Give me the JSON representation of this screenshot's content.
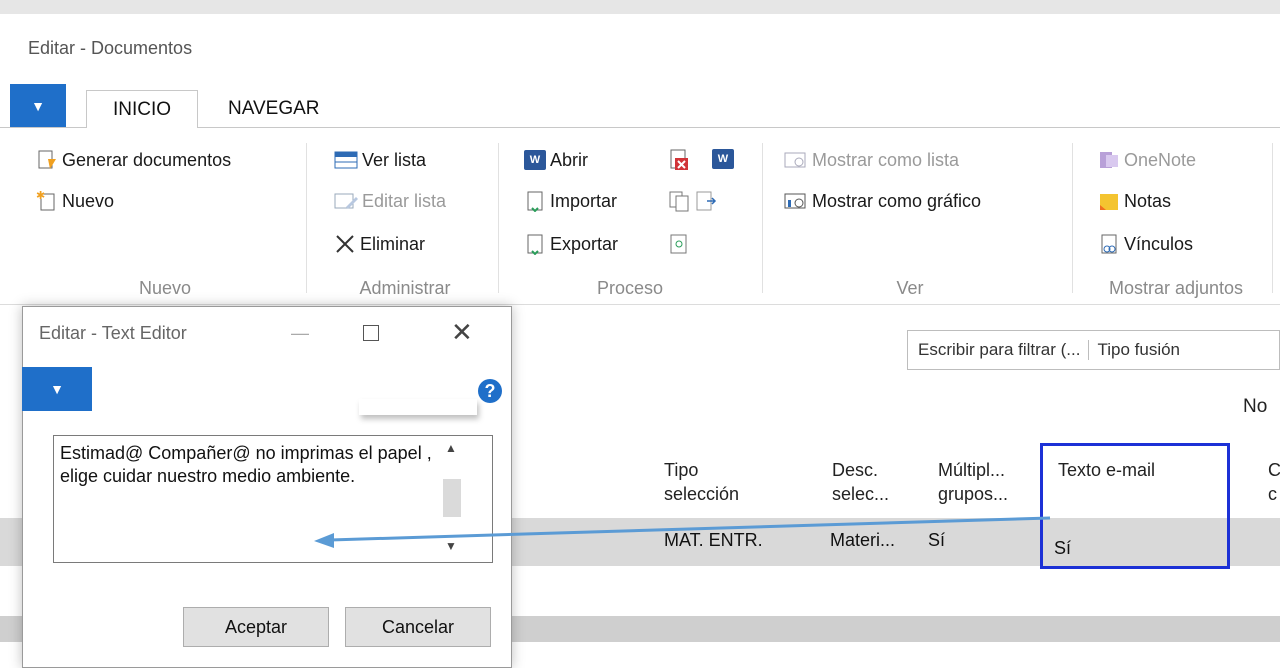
{
  "window": {
    "title": "Editar - Documentos"
  },
  "tabs": [
    {
      "label": "INICIO"
    },
    {
      "label": "NAVEGAR"
    }
  ],
  "ribbon": {
    "nuevo": {
      "items": [
        "Generar documentos",
        "Nuevo"
      ],
      "label": "Nuevo"
    },
    "administrar": {
      "items": [
        "Ver lista",
        "Editar lista",
        "Eliminar"
      ],
      "label": "Administrar"
    },
    "proceso": {
      "items": [
        "Abrir",
        "Importar",
        "Exportar"
      ],
      "label": "Proceso"
    },
    "ver": {
      "items": [
        "Mostrar como lista",
        "Mostrar como gráfico"
      ],
      "label": "Ver"
    },
    "adjuntos": {
      "items": [
        "OneNote",
        "Notas",
        "Vínculos"
      ],
      "label": "Mostrar adjuntos"
    }
  },
  "filter": {
    "search": "Escribir para filtrar (...",
    "field": "Tipo fusión"
  },
  "no_label": "No",
  "grid": {
    "headers": [
      "Tipo selección",
      "Desc. selec...",
      "Múltipl... grupos...",
      "Texto e-mail",
      "C c"
    ],
    "headers_lines": [
      [
        "Tipo",
        "selección"
      ],
      [
        "Desc.",
        "selec..."
      ],
      [
        "Múltipl...",
        "grupos..."
      ],
      [
        "Texto e-mail",
        ""
      ],
      [
        "C",
        "c"
      ]
    ],
    "row": [
      "MAT. ENTR.",
      "Materi...",
      "Sí",
      "Sí"
    ]
  },
  "dialog": {
    "title": "Editar - Text Editor",
    "text": "Estimad@ Compañer@ no imprimas el papel , elige cuidar nuestro medio ambiente.",
    "ok": "Aceptar",
    "cancel": "Cancelar",
    "help": "?"
  },
  "colors": {
    "accent": "#1f6fc9",
    "highlight": "#1c31d6",
    "arrow": "#5b9bd5"
  }
}
